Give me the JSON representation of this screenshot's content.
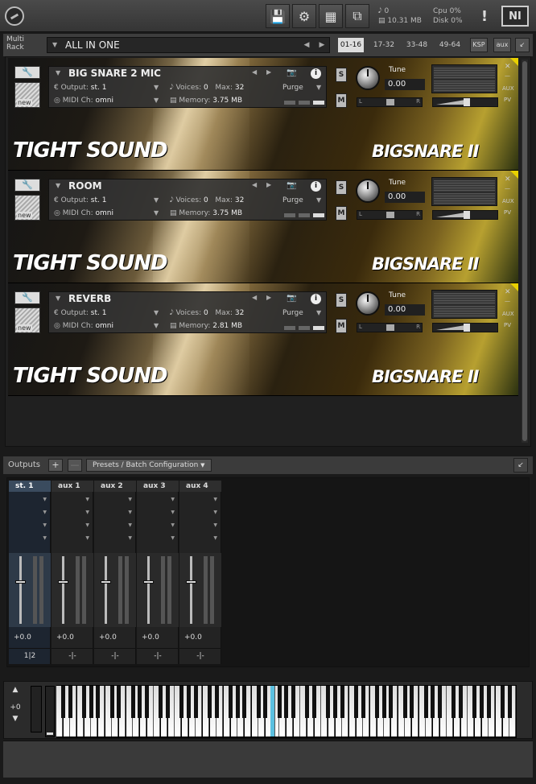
{
  "topbar": {
    "stats_voices": "0",
    "stats_memory": "10.31 MB",
    "cpu_label": "Cpu",
    "cpu_value": "0%",
    "disk_label": "Disk",
    "disk_value": "0%",
    "warning": "!",
    "ni_logo": "NI"
  },
  "rack": {
    "title_line1": "Multi",
    "title_line2": "Rack",
    "name": "ALL IN ONE",
    "pages": [
      "01-16",
      "17-32",
      "33-48",
      "49-64"
    ],
    "ksp": "KSP",
    "aux": "aux"
  },
  "instruments": [
    {
      "name": "BIG SNARE 2 MIC",
      "output": "st. 1",
      "midi": "omni",
      "voices": "0",
      "max": "32",
      "memory": "3.75 MB",
      "purge": "Purge",
      "tune_label": "Tune",
      "tune": "0.00",
      "art_left": "TIGHT SOUND",
      "art_right": "BIGSNARE II"
    },
    {
      "name": "ROOM",
      "output": "st. 1",
      "midi": "omni",
      "voices": "0",
      "max": "32",
      "memory": "3.75 MB",
      "purge": "Purge",
      "tune_label": "Tune",
      "tune": "0.00",
      "art_left": "TIGHT SOUND",
      "art_right": "BIGSNARE II"
    },
    {
      "name": "REVERB",
      "output": "st. 1",
      "midi": "omni",
      "voices": "0",
      "max": "32",
      "memory": "2.81 MB",
      "purge": "Purge",
      "tune_label": "Tune",
      "tune": "0.00",
      "art_left": "TIGHT SOUND",
      "art_right": "BIGSNARE II"
    }
  ],
  "labels": {
    "output": "Output:",
    "midi": "MIDI Ch:",
    "voices": "Voices:",
    "max": "Max:",
    "memory": "Memory:",
    "s": "S",
    "m": "M",
    "pan_l": "L",
    "pan_r": "R",
    "new": "new",
    "aux": "AUX",
    "pv": "PV"
  },
  "outputs": {
    "title": "Outputs",
    "preset_button": "Presets / Batch Configuration",
    "channels": [
      {
        "name": "st. 1",
        "volume": "+0.0",
        "routing": "1|2"
      },
      {
        "name": "aux 1",
        "volume": "+0.0",
        "routing": "-|-"
      },
      {
        "name": "aux 2",
        "volume": "+0.0",
        "routing": "-|-"
      },
      {
        "name": "aux 3",
        "volume": "+0.0",
        "routing": "-|-"
      },
      {
        "name": "aux 4",
        "volume": "+0.0",
        "routing": "-|-"
      }
    ]
  },
  "keyboard": {
    "octave_shift": "+0",
    "highlighted_key_color": "#5bc0e0"
  },
  "colors": {
    "accent_yellow": "#e8d000",
    "active_channel": "#3a4b5e"
  }
}
